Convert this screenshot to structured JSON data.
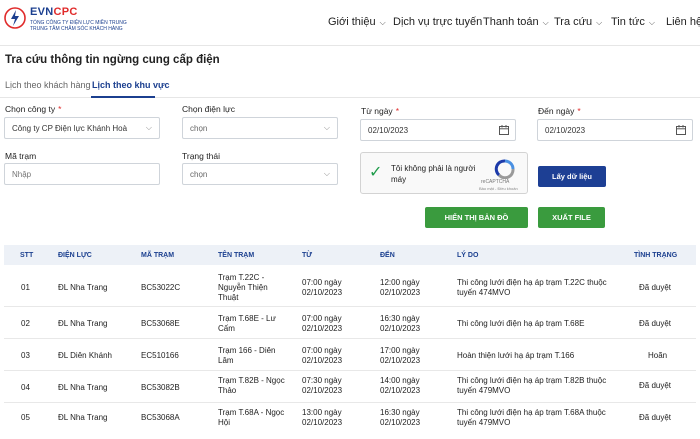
{
  "header": {
    "logo_brand_a": "EVN",
    "logo_brand_b": "CPC",
    "logo_sub1": "TỔNG CÔNG TY ĐIỆN LỰC MIỀN TRUNG",
    "logo_sub2": "TRUNG TÂM CHĂM SÓC KHÁCH HÀNG",
    "nav": [
      {
        "label": "Giới thiệu",
        "has_menu": true
      },
      {
        "label": "Dịch vụ trực tuyến",
        "has_menu": false
      },
      {
        "label": "Thanh toán",
        "has_menu": true
      },
      {
        "label": "Tra cứu",
        "has_menu": true
      },
      {
        "label": "Tin tức",
        "has_menu": true
      },
      {
        "label": "Liên hệ",
        "has_menu": false
      }
    ]
  },
  "page": {
    "title": "Tra cứu thông tin ngừng cung cấp điện",
    "tabs": [
      {
        "label": "Lịch theo khách hàng",
        "active": false
      },
      {
        "label": "Lịch theo khu vực",
        "active": true
      }
    ]
  },
  "form": {
    "company_label": "Chọn công ty",
    "company_value": "Công ty CP Điện lực Khánh Hoà",
    "unit_label": "Chọn điện lực",
    "unit_value": "chọn",
    "from_label": "Từ ngày",
    "from_value": "02/10/2023",
    "to_label": "Đến ngày",
    "to_value": "02/10/2023",
    "station_label": "Mã trạm",
    "station_placeholder": "Nhập",
    "status_label": "Trạng thái",
    "status_value": "chọn",
    "required_mark": "*",
    "captcha_text": "Tôi không phải là người máy",
    "captcha_brand": "reCAPTCHA",
    "captcha_links": "Bảo mật - Điều khoản",
    "fetch_button": "Lấy dữ liệu",
    "map_button": "HIỂN THỊ BẢN ĐỒ",
    "export_button": "XUẤT FILE"
  },
  "table": {
    "headers": [
      "STT",
      "ĐIỆN LỰC",
      "MÃ TRẠM",
      "TÊN TRẠM",
      "TỪ",
      "ĐẾN",
      "LÝ DO",
      "TÌNH TRẠNG"
    ],
    "rows": [
      {
        "stt": "01",
        "unit": "ĐL Nha Trang",
        "code": "BC53022C",
        "name": "Trạm T.22C - Nguyễn Thiện Thuật",
        "from_time": "07:00 ngày",
        "from_date": "02/10/2023",
        "to_time": "12:00 ngày",
        "to_date": "02/10/2023",
        "reason": "Thi công lưới điện hạ áp trạm T.22C thuộc tuyến 474MVO",
        "status": "Đã duyệt"
      },
      {
        "stt": "02",
        "unit": "ĐL Nha Trang",
        "code": "BC53068E",
        "name": "Trạm T.68E - Lư Cấm",
        "from_time": "07:00 ngày",
        "from_date": "02/10/2023",
        "to_time": "16:30 ngày",
        "to_date": "02/10/2023",
        "reason": "Thi công lưới điện hạ áp trạm T.68E",
        "status": "Đã duyệt"
      },
      {
        "stt": "03",
        "unit": "ĐL Diên Khánh",
        "code": "EC510166",
        "name": "Trạm 166 - Diên Lâm",
        "from_time": "07:00 ngày",
        "from_date": "02/10/2023",
        "to_time": "17:00 ngày",
        "to_date": "02/10/2023",
        "reason": "Hoàn thiện lưới hạ áp trạm T.166",
        "status": "Hoãn"
      },
      {
        "stt": "04",
        "unit": "ĐL Nha Trang",
        "code": "BC53082B",
        "name": "Trạm T.82B - Ngọc Thảo",
        "from_time": "07:30 ngày",
        "from_date": "02/10/2023",
        "to_time": "14:00 ngày",
        "to_date": "02/10/2023",
        "reason": "Thi công lưới điện hạ áp trạm T.82B thuộc tuyến 479MVO",
        "status": "Đã duyệt"
      },
      {
        "stt": "05",
        "unit": "ĐL Nha Trang",
        "code": "BC53068A",
        "name": "Trạm T.68A - Ngọc Hội",
        "from_time": "13:00 ngày",
        "from_date": "02/10/2023",
        "to_time": "16:30 ngày",
        "to_date": "02/10/2023",
        "reason": "Thi công lưới điện hạ áp trạm T.68A thuộc tuyến 479MVO",
        "status": "Đã duyệt"
      }
    ]
  },
  "colors": {
    "brand_blue": "#1b3f8f",
    "brand_red": "#e02b2b",
    "green": "#3a9b3e"
  }
}
